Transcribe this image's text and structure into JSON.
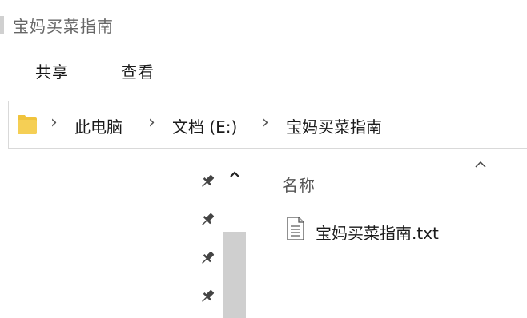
{
  "window": {
    "title": "宝妈买菜指南"
  },
  "ribbon": {
    "tabs": [
      {
        "label": "共享"
      },
      {
        "label": "查看"
      }
    ]
  },
  "address": {
    "breadcrumbs": [
      {
        "label": "此电脑"
      },
      {
        "label": "文档 (E:)"
      },
      {
        "label": "宝妈买菜指南"
      }
    ]
  },
  "file_list": {
    "column_header": "名称",
    "files": [
      {
        "name": "宝妈买菜指南.txt",
        "icon": "text-file-icon"
      }
    ]
  },
  "colors": {
    "folder": "#f0c33c",
    "scroll_thumb": "#cfcfcf"
  }
}
